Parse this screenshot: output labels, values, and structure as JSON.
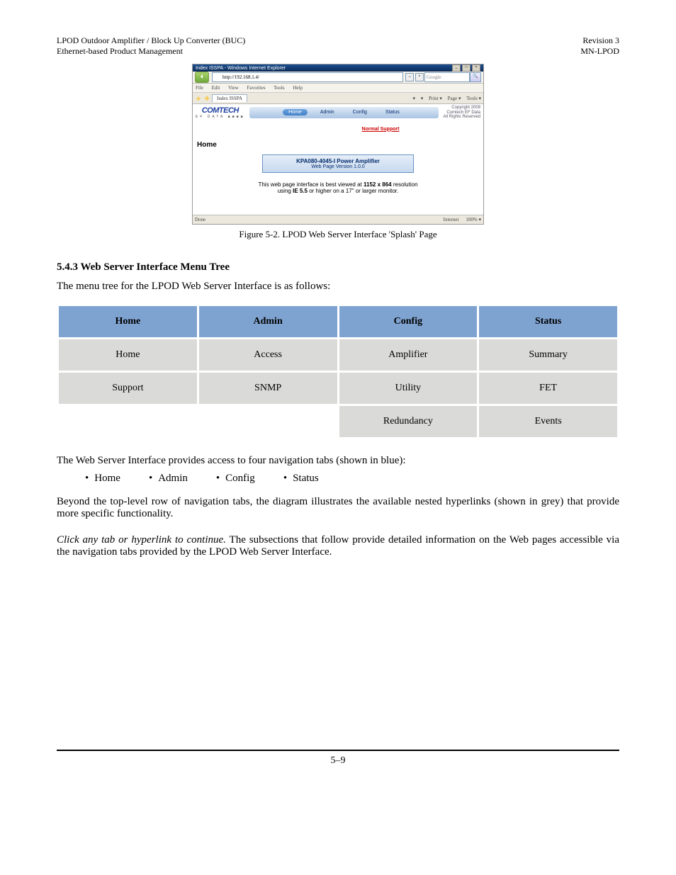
{
  "header": {
    "left_line1": "LPOD Outdoor Amplifier / Block Up Converter (BUC)",
    "left_line2": "Ethernet-based Product Management",
    "right_line1": "Revision 3",
    "right_line2": "MN-LPOD"
  },
  "browser": {
    "window_title": "Index ISSPA - Windows Internet Explorer",
    "address": "http://192.168.1.4/",
    "min_btn": "_",
    "max_btn": "□",
    "close_btn": "×",
    "menus": [
      "File",
      "Edit",
      "View",
      "Favorites",
      "Tools",
      "Help"
    ],
    "tab_label": "Index ISSPA",
    "tool_icons": {
      "a": "▾",
      "b": "▾",
      "print": "Print ▾",
      "page": "Page ▾",
      "tools": "Tools ▾"
    },
    "search_placeholder": "Google",
    "go_symbol": "→",
    "x_symbol": "×",
    "search_icon": "🔍"
  },
  "webpage": {
    "logo_main": "COMTECH",
    "logo_sub": "EF DATA ■■■■",
    "ribbon": {
      "home": "Home",
      "admin": "Admin",
      "config": "Config",
      "status": "Status"
    },
    "copyright": [
      "Copyright 2009",
      "Comtech EF Data",
      "All Rights Reserved"
    ],
    "support_link": "Normal Support",
    "section_label": "Home",
    "amp_title": "KPA080-4045-I  Power Amplifier",
    "amp_sub": "Web Page Version 1.0.0",
    "view_rec_1a": "This web page interface is best viewed at ",
    "view_rec_1b": "1152 x 864",
    "view_rec_1c": " resolution",
    "view_rec_2a": "using ",
    "view_rec_2b": "IE 5.5",
    "view_rec_2c": " or higher on a 17\" or larger monitor."
  },
  "statusbar": {
    "left": "Done",
    "right": "Internet",
    "zoom": "100%  ▾"
  },
  "figure_caption": "Figure 5-2. LPOD Web Server Interface 'Splash' Page",
  "section_heading": "5.4.3 Web Server Interface Menu Tree",
  "intro_line": "The menu tree for the LPOD Web Server Interface is as follows:",
  "table": {
    "headers": [
      "Home",
      "Admin",
      "Config",
      "Status"
    ],
    "rows": [
      [
        "Home",
        "Access",
        "Amplifier",
        "Summary"
      ],
      [
        "Support",
        "SNMP",
        "Utility",
        "FET"
      ],
      [
        "",
        "",
        "Redundancy",
        "Events"
      ]
    ]
  },
  "after_table": "The Web Server Interface provides access to four navigation tabs (shown in blue):",
  "bullets": {
    "b1": "Home",
    "b2": "Admin",
    "b3": "Config",
    "b4": "Status"
  },
  "para1": "Beyond the top-level row of navigation tabs, the diagram illustrates the available nested hyperlinks (shown in grey) that provide more specific functionality.",
  "para2_a": "Click any tab or hyperlink to continue.",
  "para2_b": " The subsections that follow provide detailed information on the Web pages accessible via the navigation tabs provided by the LPOD Web Server Interface.",
  "footer_page": "5–9"
}
